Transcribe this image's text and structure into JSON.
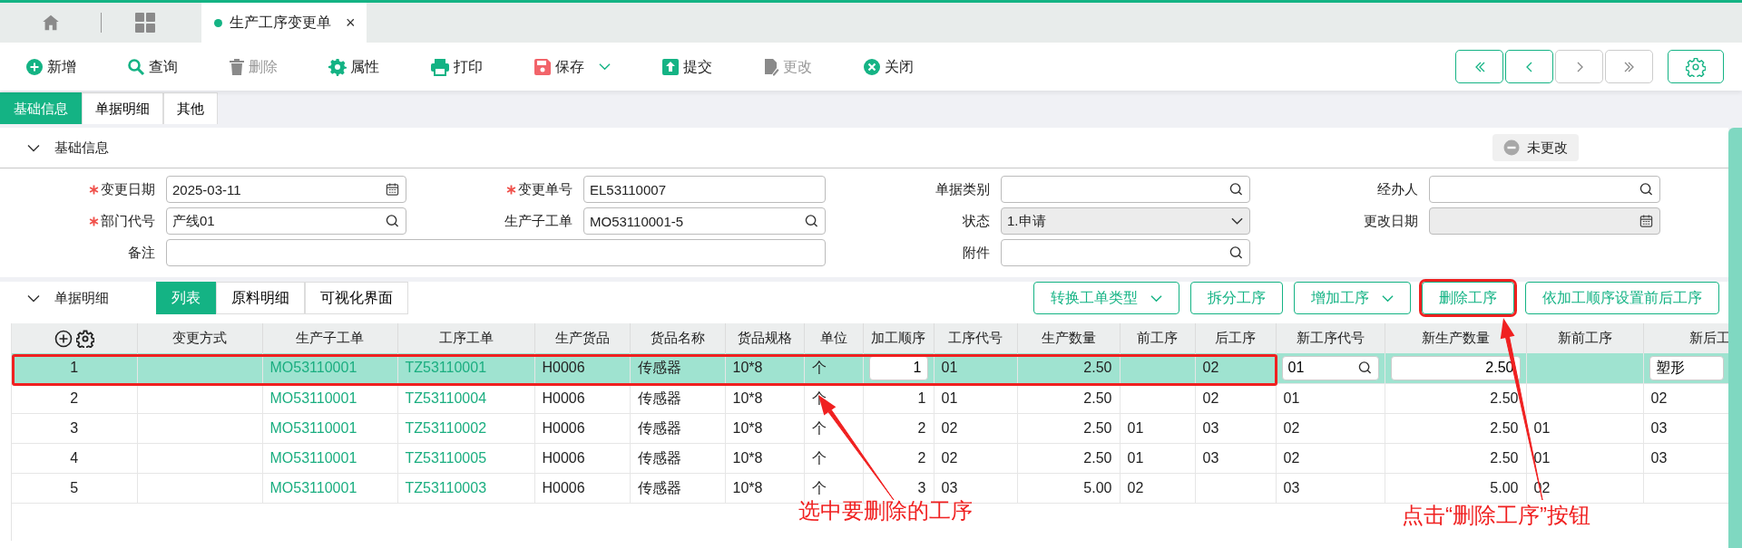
{
  "tab_bar": {
    "tabs": [
      {
        "label": "生产工序变更单",
        "selected": true,
        "close": "×"
      }
    ]
  },
  "toolbar": {
    "buttons": [
      {
        "label": "新增",
        "kind": "add",
        "disabled": false
      },
      {
        "label": "查询",
        "kind": "search",
        "disabled": false
      },
      {
        "label": "删除",
        "kind": "delete",
        "disabled": true
      },
      {
        "label": "属性",
        "kind": "settings",
        "disabled": false
      },
      {
        "label": "打印",
        "kind": "print",
        "disabled": false
      },
      {
        "label": "保存",
        "kind": "save",
        "disabled": false,
        "dropdown": true
      },
      {
        "label": "提交",
        "kind": "submit",
        "disabled": false
      },
      {
        "label": "更改",
        "kind": "edit",
        "disabled": true
      },
      {
        "label": "关闭",
        "kind": "close",
        "disabled": false
      }
    ],
    "record_nav": [
      {
        "kind": "first",
        "disabled": false
      },
      {
        "kind": "prev",
        "disabled": false
      },
      {
        "kind": "next",
        "disabled": true
      },
      {
        "kind": "last",
        "disabled": true
      }
    ]
  },
  "page_tabs": [
    {
      "label": "基础信息",
      "selected": true
    },
    {
      "label": "单据明细",
      "selected": false
    },
    {
      "label": "其他",
      "selected": false
    }
  ],
  "basic_section": {
    "title": "基础信息",
    "expanded": true,
    "status_badge": "未更改",
    "fields": [
      {
        "label": "变更日期",
        "required": true,
        "kind": "date",
        "value": "2025-03-11",
        "disabled": false
      },
      {
        "label": "变更单号",
        "required": true,
        "kind": "text",
        "value": "EL53110007",
        "disabled": false
      },
      {
        "label": "单据类别",
        "required": false,
        "kind": "lookup",
        "disabled": false
      },
      {
        "label": "经办人",
        "required": false,
        "kind": "lookup",
        "disabled": false
      },
      {
        "label": "部门代号",
        "required": true,
        "kind": "lookup",
        "value": "产线01",
        "disabled": false
      },
      {
        "label": "生产子工单",
        "required": false,
        "kind": "lookup",
        "value": "MO53110001-5",
        "disabled": false
      },
      {
        "label": "状态",
        "required": false,
        "kind": "select",
        "value": "1.申请",
        "disabled": true
      },
      {
        "label": "更改日期",
        "required": false,
        "kind": "date",
        "disabled": true
      },
      {
        "label": "备注",
        "required": false,
        "kind": "text",
        "wide": true,
        "disabled": false
      },
      {
        "label": "附件",
        "required": false,
        "kind": "lookup",
        "disabled": false
      }
    ]
  },
  "detail_section": {
    "title": "单据明细",
    "expanded": true,
    "view_tabs": [
      {
        "label": "列表",
        "selected": true
      },
      {
        "label": "原料明细",
        "selected": false
      },
      {
        "label": "可视化界面",
        "selected": false
      }
    ],
    "actions": [
      {
        "label": "转换工单类型",
        "dropdown": true,
        "highlighted": false
      },
      {
        "label": "拆分工序",
        "highlighted": false
      },
      {
        "label": "增加工序",
        "dropdown": true,
        "highlighted": false
      },
      {
        "label": "删除工序",
        "highlighted": true
      },
      {
        "label": "依加工顺序设置前后工序",
        "highlighted": false
      }
    ],
    "table": {
      "columns": [
        {
          "kind": "index"
        },
        {
          "label": "变更方式",
          "kind": "text"
        },
        {
          "label": "生产子工单",
          "kind": "link"
        },
        {
          "label": "工序工单",
          "kind": "link"
        },
        {
          "label": "生产货品",
          "kind": "text"
        },
        {
          "label": "货品名称",
          "kind": "text"
        },
        {
          "label": "货品规格",
          "kind": "text"
        },
        {
          "label": "单位",
          "kind": "text"
        },
        {
          "label": "加工顺序",
          "kind": "number",
          "editable": true
        },
        {
          "label": "工序代号",
          "kind": "text"
        },
        {
          "label": "生产数量",
          "kind": "number"
        },
        {
          "label": "前工序",
          "kind": "text"
        },
        {
          "label": "后工序",
          "kind": "text"
        },
        {
          "label": "新工序代号",
          "kind": "text",
          "editable": true,
          "lookup": true
        },
        {
          "label": "新生产数量",
          "kind": "number",
          "editable": true
        },
        {
          "label": "新前工序",
          "kind": "text"
        },
        {
          "label": "新后工",
          "kind": "text",
          "editable": true
        }
      ],
      "rows": [
        {
          "selected": true,
          "highlighted": true,
          "cells": [
            "1",
            null,
            "MO53110001",
            "TZ53110001",
            "H0006",
            "传感器",
            "10*8",
            "个",
            "1",
            "01",
            "2.50",
            null,
            "02",
            "01",
            "2.50",
            null,
            "塑形"
          ]
        },
        {
          "selected": false,
          "highlighted": false,
          "cells": [
            "2",
            null,
            "MO53110001",
            "TZ53110004",
            "H0006",
            "传感器",
            "10*8",
            "个",
            "1",
            "01",
            "2.50",
            null,
            "02",
            "01",
            "2.50",
            null,
            "02"
          ]
        },
        {
          "selected": false,
          "highlighted": false,
          "cells": [
            "3",
            null,
            "MO53110001",
            "TZ53110002",
            "H0006",
            "传感器",
            "10*8",
            "个",
            "2",
            "02",
            "2.50",
            "01",
            "03",
            "02",
            "2.50",
            "01",
            "03"
          ]
        },
        {
          "selected": false,
          "highlighted": false,
          "cells": [
            "4",
            null,
            "MO53110001",
            "TZ53110005",
            "H0006",
            "传感器",
            "10*8",
            "个",
            "2",
            "02",
            "2.50",
            "01",
            "03",
            "02",
            "2.50",
            "01",
            "03"
          ]
        },
        {
          "selected": false,
          "highlighted": false,
          "cells": [
            "5",
            null,
            "MO53110001",
            "TZ53110003",
            "H0006",
            "传感器",
            "10*8",
            "个",
            "3",
            "03",
            "5.00",
            "02",
            null,
            "03",
            "5.00",
            "02",
            null
          ]
        }
      ]
    }
  },
  "annotations": [
    {
      "text": "选中要删除的工序"
    },
    {
      "text": "点击“删除工序”按钮"
    }
  ]
}
